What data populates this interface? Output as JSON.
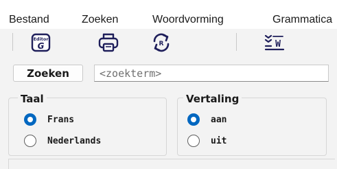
{
  "menu": {
    "items": [
      {
        "label": "Bestand"
      },
      {
        "label": "Zoeken"
      },
      {
        "label": "Woordvorming"
      },
      {
        "label": "Grammatica"
      }
    ]
  },
  "toolbar": {
    "buttons": [
      {
        "icon": "editor-g-icon",
        "label_top": "Editor",
        "label_main": "G"
      },
      {
        "icon": "print-icon"
      },
      {
        "icon": "refresh-r-icon",
        "label_main": "R"
      },
      {
        "icon": "word-list-icon",
        "label_main": "W"
      }
    ]
  },
  "search": {
    "button_label": "Zoeken",
    "placeholder": "<zoekterm>",
    "value": ""
  },
  "language_group": {
    "title": "Taal",
    "options": [
      {
        "label": "Frans",
        "selected": true
      },
      {
        "label": "Nederlands",
        "selected": false
      }
    ]
  },
  "translation_group": {
    "title": "Vertaling",
    "options": [
      {
        "label": "aan",
        "selected": true
      },
      {
        "label": "uit",
        "selected": false
      }
    ]
  },
  "colors": {
    "accent": "#0067c0",
    "background": "#f3f3f3",
    "icon_dark": "#1e1e5a"
  }
}
